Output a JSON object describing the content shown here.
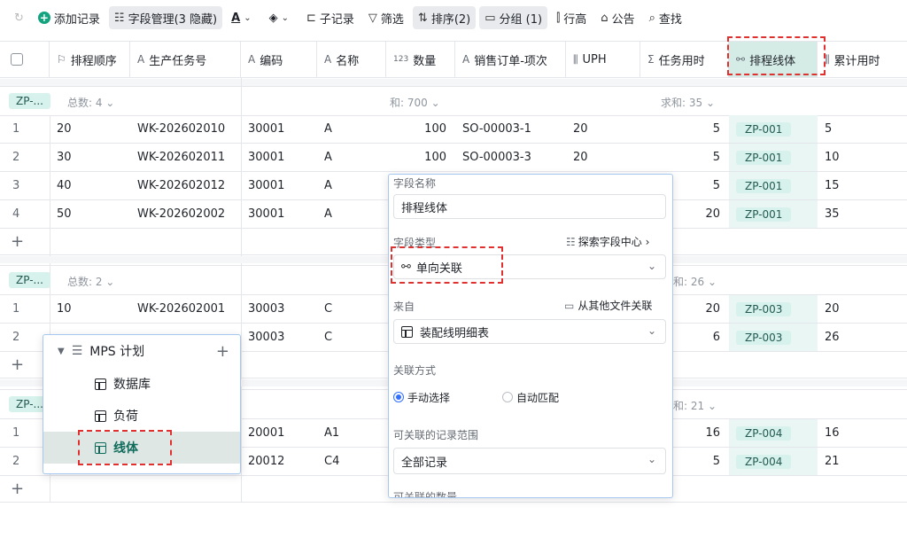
{
  "toolbar": {
    "redo": "↻",
    "add_record": "添加记录",
    "field_mgmt": "字段管理(3 隐藏)",
    "text_style": "A",
    "fill": "◈",
    "sub_record": "子记录",
    "filter": "筛选",
    "sort": "排序(2)",
    "group": "分组 (1)",
    "row_height": "行高",
    "notice": "公告",
    "search": "查找"
  },
  "columns": [
    {
      "icon": "⚐",
      "label": "排程顺序"
    },
    {
      "icon": "A",
      "label": "生产任务号"
    },
    {
      "icon": "A",
      "label": "编码"
    },
    {
      "icon": "A",
      "label": "名称"
    },
    {
      "icon": "123",
      "label": "数量"
    },
    {
      "icon": "A",
      "label": "销售订单-项次"
    },
    {
      "icon": "⫼",
      "label": "UPH"
    },
    {
      "icon": "Σ",
      "label": "任务用时"
    },
    {
      "icon": "⚯",
      "label": "排程线体"
    },
    {
      "icon": "⫼",
      "label": "累计用时"
    }
  ],
  "groups": [
    {
      "tag": "ZP-...",
      "count": "总数: 4 ⌄",
      "sum_qty": "和: 700 ⌄",
      "sum_time": "求和: 35 ⌄",
      "rows": [
        {
          "idx": "1",
          "order": "20",
          "task": "WK-202602010",
          "code": "30001",
          "name": "A",
          "qty": "100",
          "so": "SO-00003-1",
          "uph": "20",
          "time": "5",
          "line": "ZP-001",
          "cum": "5"
        },
        {
          "idx": "2",
          "order": "30",
          "task": "WK-202602011",
          "code": "30001",
          "name": "A",
          "qty": "100",
          "so": "SO-00003-3",
          "uph": "20",
          "time": "5",
          "line": "ZP-001",
          "cum": "10"
        },
        {
          "idx": "3",
          "order": "40",
          "task": "WK-202602012",
          "code": "30001",
          "name": "A",
          "qty": "",
          "so": "",
          "uph": "",
          "time": "5",
          "line": "ZP-001",
          "cum": "15"
        },
        {
          "idx": "4",
          "order": "50",
          "task": "WK-202602002",
          "code": "30001",
          "name": "A",
          "qty": "",
          "so": "",
          "uph": "",
          "time": "20",
          "line": "ZP-001",
          "cum": "35"
        }
      ]
    },
    {
      "tag": "ZP-...",
      "count": "总数: 2 ⌄",
      "sum_qty": "",
      "sum_time": "和: 26 ⌄",
      "rows": [
        {
          "idx": "1",
          "order": "10",
          "task": "WK-202602001",
          "code": "30003",
          "name": "C",
          "qty": "",
          "so": "",
          "uph": "",
          "time": "20",
          "line": "ZP-003",
          "cum": "20"
        },
        {
          "idx": "2",
          "order": "",
          "task": "",
          "code": "30003",
          "name": "C",
          "qty": "",
          "so": "",
          "uph": "",
          "time": "6",
          "line": "ZP-003",
          "cum": "26"
        }
      ]
    },
    {
      "tag": "ZP-...",
      "count": "",
      "sum_qty": "",
      "sum_time": "和: 21 ⌄",
      "rows": [
        {
          "idx": "1",
          "order": "",
          "task": "",
          "code": "20001",
          "name": "A1",
          "qty": "",
          "so": "",
          "uph": "",
          "time": "16",
          "line": "ZP-004",
          "cum": "16"
        },
        {
          "idx": "2",
          "order": "",
          "task": "",
          "code": "20012",
          "name": "C4",
          "qty": "",
          "so": "",
          "uph": "",
          "time": "5",
          "line": "ZP-004",
          "cum": "21"
        }
      ]
    }
  ],
  "panel": {
    "field_name_label": "字段名称",
    "field_name_value": "排程线体",
    "field_type_label": "字段类型",
    "explore": "探索字段中心 ›",
    "field_type_value": "单向关联",
    "from_label": "来自",
    "other_file": "从其他文件关联",
    "from_value": "装配线明细表",
    "method_label": "关联方式",
    "manual": "手动选择",
    "auto": "自动匹配",
    "scope_label": "可关联的记录范围",
    "scope_value": "全部记录",
    "count_label": "可关联的数量"
  },
  "tree": {
    "root": "MPS 计划",
    "items": [
      "数据库",
      "负荷",
      "线体"
    ]
  }
}
